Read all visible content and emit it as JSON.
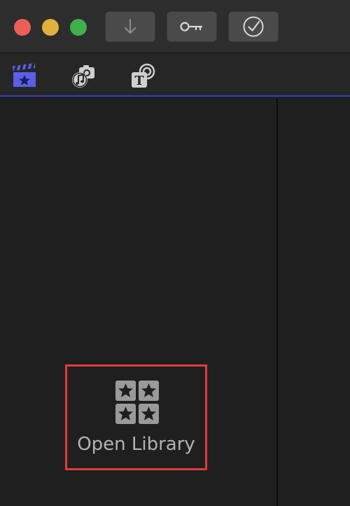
{
  "window_controls": {
    "close_color": "#ec5f57",
    "minimize_color": "#e0b13c",
    "maximize_color": "#3fb04a"
  },
  "toolbar": {
    "buttons": [
      {
        "icon": "import-arrow-down-icon"
      },
      {
        "icon": "key-icon"
      },
      {
        "icon": "checkmark-circle-icon"
      }
    ]
  },
  "browser_tabs": [
    {
      "icon": "clapper-star-icon",
      "selected": true,
      "accent": "#5b5fe6"
    },
    {
      "icon": "camera-music-icon",
      "selected": false
    },
    {
      "icon": "title-generator-icon",
      "selected": false
    }
  ],
  "open_library": {
    "icon": "library-stars-icon",
    "label": "Open Library",
    "highlight_color": "#e23b3b"
  }
}
